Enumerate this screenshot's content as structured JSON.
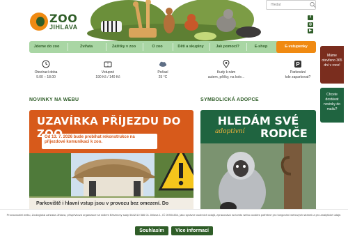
{
  "header": {
    "logo_name": "ZOO",
    "logo_city": "JIHLAVA",
    "search_placeholder": "Hledat",
    "social": [
      {
        "icon": "facebook-icon",
        "glyph": "f"
      },
      {
        "icon": "instagram-icon",
        "glyph": "◎"
      },
      {
        "icon": "youtube-icon",
        "glyph": "▶"
      }
    ]
  },
  "nav": {
    "items": [
      "Jdeme do zoo",
      "Zvířata",
      "Zážitky v zoo",
      "O zoo",
      "Děti a skupiny",
      "Jak pomoci?",
      "E-shop"
    ],
    "cta": "E-vstupenky"
  },
  "info": [
    {
      "icon": "clock-icon",
      "title": "Otevírací doba",
      "value": "9.00 – 18.00"
    },
    {
      "icon": "ticket-icon",
      "title": "Vstupné",
      "value": "190 Kč / 140 Kč"
    },
    {
      "icon": "cloud-icon",
      "title": "Počasí",
      "value": "25 °C"
    },
    {
      "icon": "location-pin-icon",
      "title": "Kudy k nám",
      "value": "autem, pěšky, na kole..."
    },
    {
      "icon": "parking-icon",
      "title": "Parkování",
      "value": "kde zaparkovat?"
    }
  ],
  "news": {
    "heading": "NOVINKY NA WEBU",
    "card_title": "UZAVÍRKA PŘÍJEZDU DO ZOO",
    "card_message": "Od 13. 7. 2026 bude probíhat rekonstrukce na příjezdové komunikaci k zoo.",
    "caption": "Parkoviště i hlavní vstup jsou v provozu bez omezení. Do"
  },
  "adoption": {
    "heading": "SYMBOLICKÁ ADOPCE",
    "line1": "HLEDÁM SVÉ",
    "line2_accent": "adoptivní",
    "line2": "RODIČE"
  },
  "side_tabs": {
    "first": "Máme otevřeno 365 dní v roce!",
    "second": "Chcete dostávat novinky do mailu?"
  },
  "cookie": {
    "text": "Provozovatel webu, Zoologická zahrada Jihlava, příspěvková organizace se sídlem Březinovy sady 5642/10 586 01 Jihlava 1, IČ 00904454, jako správce osobních údajů, zpracovává na tomto webu cookies potřebné pro fungování webových stránek a pro analytické údaje.",
    "accept": "Souhlasím",
    "more": "Více informací"
  },
  "colors": {
    "brand_green": "#2f5d28",
    "nav_green": "#a9d6a4",
    "accent_orange": "#f08a12",
    "news_orange": "#d75a1b",
    "adoption_green": "#1f6440",
    "side_red": "#7a2d1e"
  }
}
